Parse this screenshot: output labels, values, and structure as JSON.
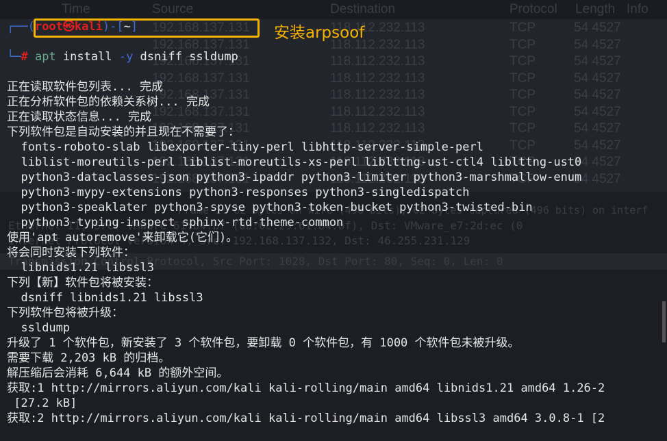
{
  "background_wireshark": {
    "columns": [
      "Time",
      "Source",
      "Destination",
      "Protocol",
      "Length",
      "Info"
    ],
    "rows": [
      {
        "source": "192.168.137.131",
        "destination": "118.112.232.113",
        "protocol": "TCP",
        "info": "54 4527"
      },
      {
        "source": "192.168.137.131",
        "destination": "118.112.232.113",
        "protocol": "TCP",
        "info": "54 4527"
      },
      {
        "source": "192.168.137.131",
        "destination": "118.112.232.113",
        "protocol": "TCP",
        "info": "54 4527"
      },
      {
        "source": "192.168.137.131",
        "destination": "118.112.232.113",
        "protocol": "TCP",
        "info": "54 4527"
      },
      {
        "source": "192.168.137.131",
        "destination": "118.112.232.113",
        "protocol": "TCP",
        "info": "54 4527"
      },
      {
        "source": "192.168.137.131",
        "destination": "118.112.232.113",
        "protocol": "TCP",
        "info": "54 4527"
      },
      {
        "source": "192.168.137.131",
        "destination": "118.112.232.113",
        "protocol": "TCP",
        "info": "54 4527"
      },
      {
        "source": "192.168.137.131",
        "destination": "118.112.232.113",
        "protocol": "TCP",
        "info": "54 4527"
      },
      {
        "source": "192.168.137.131",
        "destination": "118.112.232.113",
        "protocol": "TCP",
        "info": "54 4527"
      },
      {
        "source": "192.168.137.131",
        "destination": "118.112.232.113",
        "protocol": "TCP",
        "info": "54 4527"
      }
    ],
    "details": [
      "Frame 1: 62 bytes on wire (496 bits), 62 bytes captured (496 bits) on interf",
      "Ethernet II, Src: VMware_61:b4:bf (00:0c:29:61:b4:bf), Dst: VMware_e7:2d:ec (0",
      "Internet Protocol Version 4, Src: 192.168.137.132, Dst: 46.255.231.129",
      "Transmission Control Protocol, Src Port: 1028, Dst Port: 80, Seq: 0, Len: 0"
    ]
  },
  "prompt": {
    "user": "root",
    "at": "㉿",
    "host": "kali",
    "dir": "~",
    "symbol": "#",
    "cmd": "apt",
    "args": " install ",
    "flag": "-y",
    "rest": " dsniff ssldump"
  },
  "annotation": "安装arpsoof",
  "output": [
    "正在读取软件包列表... 完成",
    "正在分析软件包的依赖关系树... 完成",
    "正在读取状态信息... 完成",
    "下列软件包是自动安装的并且现在不需要了：",
    "  fonts-roboto-slab libexporter-tiny-perl libhttp-server-simple-perl",
    "  liblist-moreutils-perl liblist-moreutils-xs-perl liblttng-ust-ctl4 liblttng-ust0",
    "  python3-dataclasses-json python3-ipaddr python3-limiter python3-marshmallow-enum",
    "  python3-mypy-extensions python3-responses python3-singledispatch",
    "  python3-speaklater python3-spyse python3-token-bucket python3-twisted-bin",
    "  python3-typing-inspect sphinx-rtd-theme-common",
    "使用'apt autoremove'来卸载它(它们)。",
    "将会同时安装下列软件：",
    "  libnids1.21 libssl3",
    "下列【新】软件包将被安装：",
    "  dsniff libnids1.21 libssl3",
    "下列软件包将被升级：",
    "  ssldump",
    "升级了 1 个软件包，新安装了 3 个软件包，要卸载 0 个软件包，有 1000 个软件包未被升级。",
    "需要下载 2,203 kB 的归档。",
    "解压缩后会消耗 6,644 kB 的额外空间。",
    "获取:1 http://mirrors.aliyun.com/kali kali-rolling/main amd64 libnids1.21 amd64 1.26-2",
    " [27.2 kB]",
    "获取:2 http://mirrors.aliyun.com/kali kali-rolling/main amd64 libssl3 amd64 3.0.8-1 [2"
  ],
  "colors": {
    "highlight": "#f5b301",
    "prompt_red": "#e0201e",
    "prompt_blue": "#3f6fd6"
  }
}
